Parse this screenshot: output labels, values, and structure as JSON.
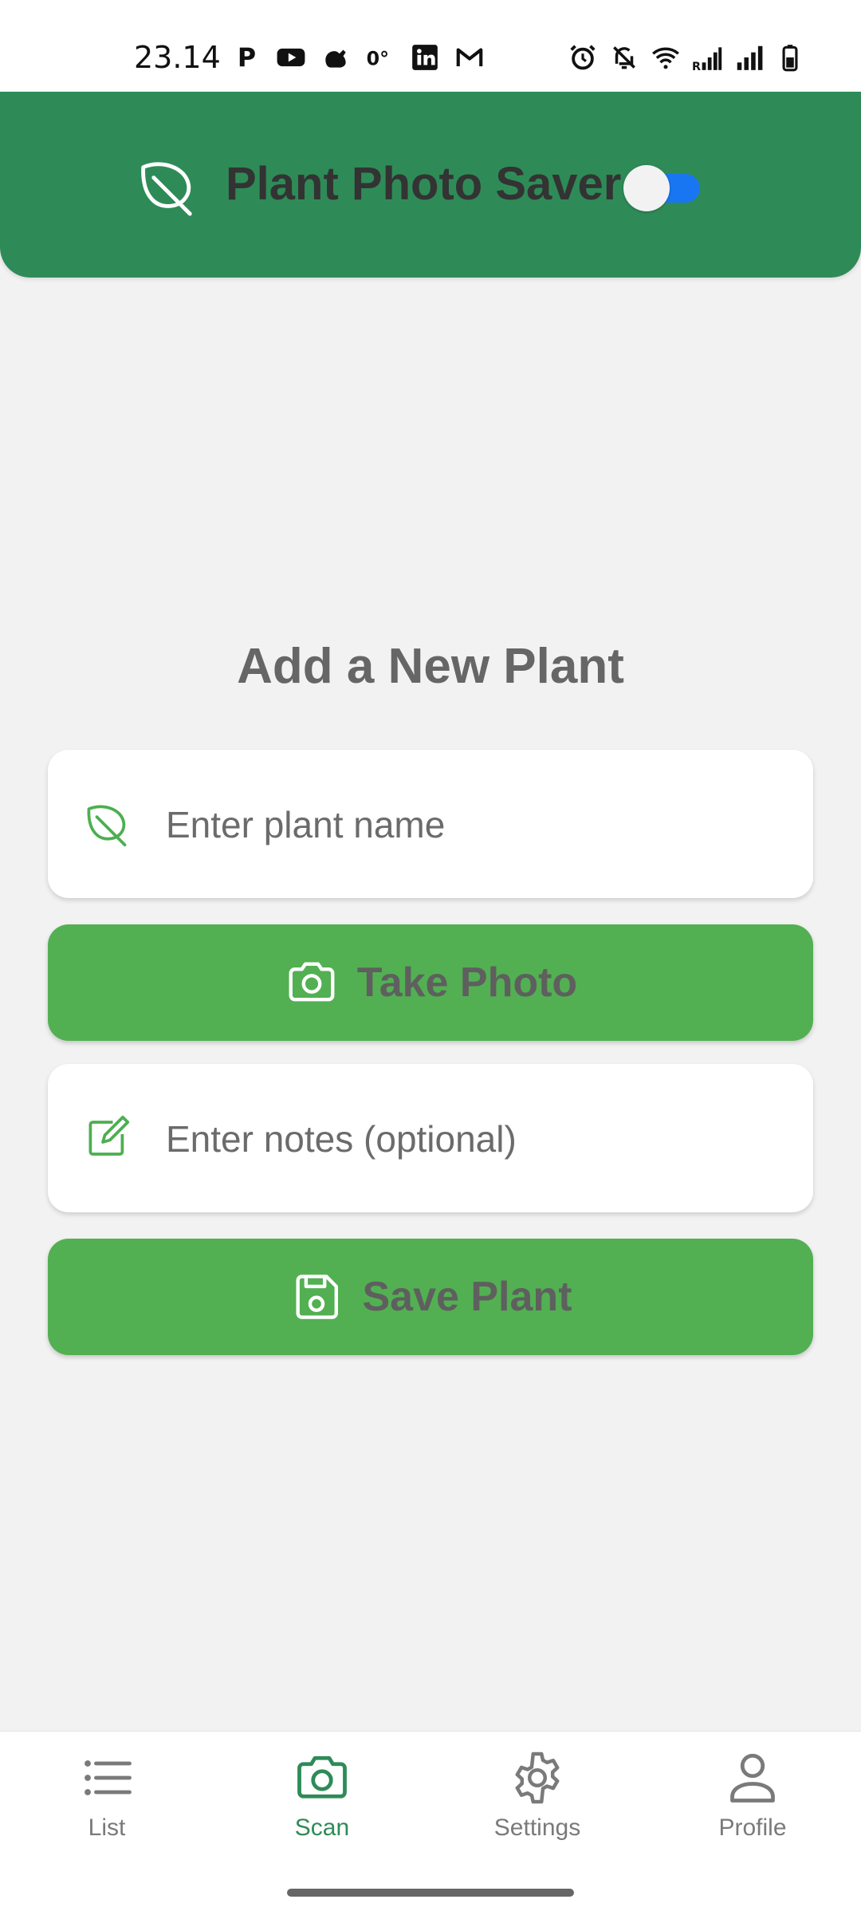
{
  "status_bar": {
    "time": "23.14",
    "left_icons": [
      "parking-icon",
      "youtube-icon",
      "squirrel-icon",
      "temperature-icon",
      "linkedin-icon",
      "gmail-icon"
    ],
    "temperature": "0°",
    "right_icons": [
      "alarm-icon",
      "mute-icon",
      "wifi-icon",
      "signal-r-icon",
      "signal-icon",
      "battery-icon"
    ]
  },
  "header": {
    "title": "Plant Photo Saver",
    "toggle_on": true
  },
  "form": {
    "title": "Add a New Plant",
    "plant_name_placeholder": "Enter plant name",
    "take_photo_label": "Take Photo",
    "notes_placeholder": "Enter notes (optional)",
    "save_label": "Save Plant"
  },
  "bottom_nav": {
    "items": [
      {
        "label": "List",
        "icon": "list-icon",
        "active": false
      },
      {
        "label": "Scan",
        "icon": "camera-icon",
        "active": true
      },
      {
        "label": "Settings",
        "icon": "gear-icon",
        "active": false
      },
      {
        "label": "Profile",
        "icon": "person-icon",
        "active": false
      }
    ]
  },
  "colors": {
    "header_green": "#2e8b57",
    "button_green": "#52b052",
    "icon_green": "#4caf50",
    "toggle_blue": "#1976f2",
    "background": "#f2f2f2"
  }
}
